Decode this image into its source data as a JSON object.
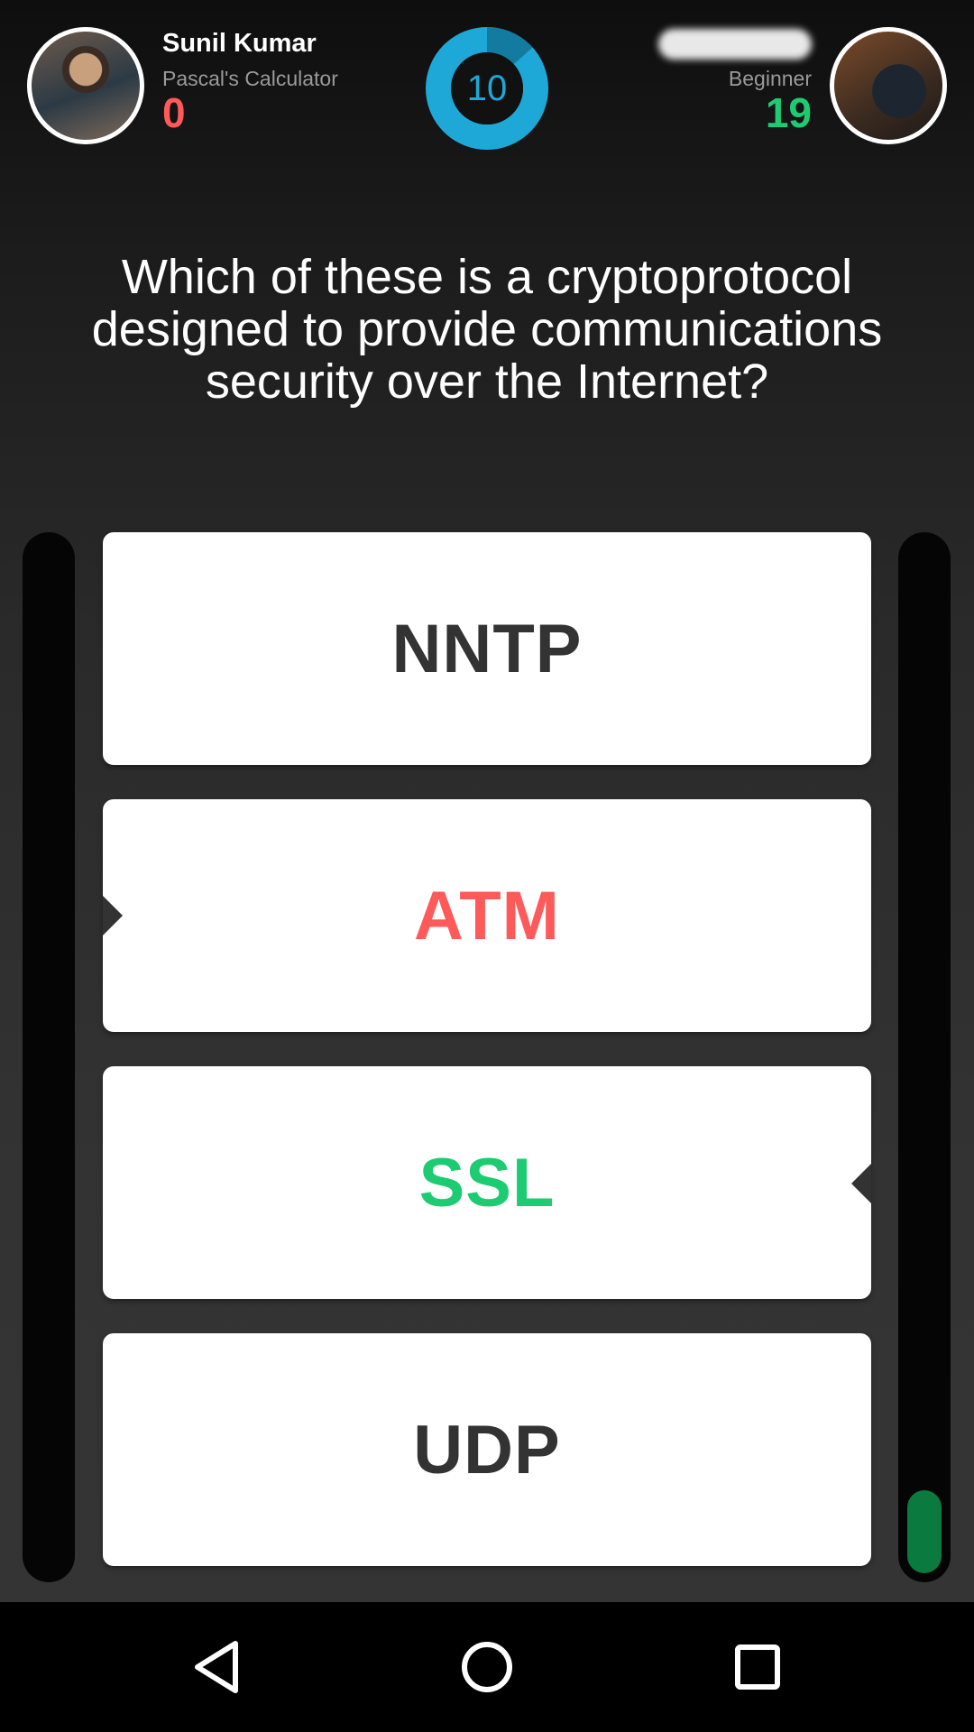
{
  "player1": {
    "name": "Sunil Kumar",
    "title": "Pascal's Calculator",
    "score": "0",
    "score_color": "#ff5a5a"
  },
  "player2": {
    "title": "Beginner",
    "score": "19",
    "score_color": "#1dcc72"
  },
  "timer": {
    "value": "10",
    "color": "#1ea8d8"
  },
  "question": "Which of these is a cryptoprotocol designed to provide communications security over the Internet?",
  "answers": [
    {
      "label": "NNTP",
      "color": "#333333"
    },
    {
      "label": "ATM",
      "color": "#ff5a5a"
    },
    {
      "label": "SSL",
      "color": "#1dcc72"
    },
    {
      "label": "UDP",
      "color": "#333333"
    }
  ],
  "progress": {
    "player1": 0,
    "player2": 0.08
  },
  "navbar": {
    "icons": [
      "back-icon",
      "home-icon",
      "recents-icon"
    ]
  }
}
